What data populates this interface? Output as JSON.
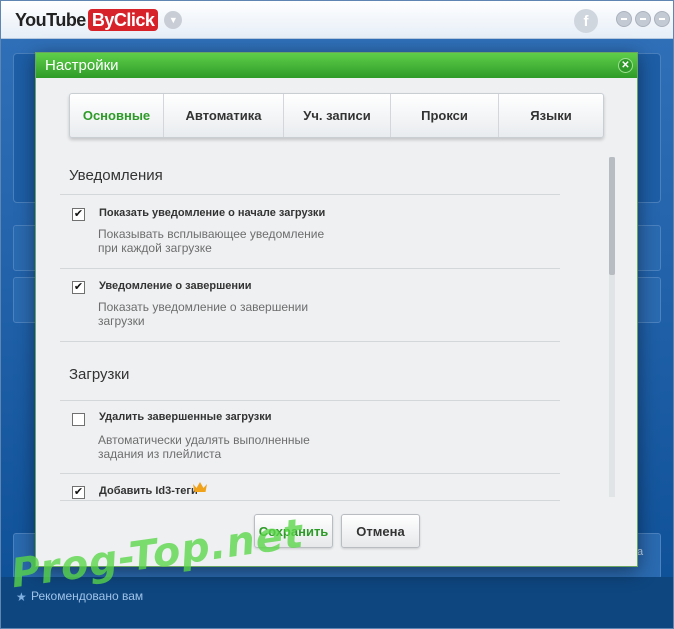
{
  "app": {
    "logo_part1": "YouTube",
    "logo_part2": "ByClick",
    "menu_icon": "chevron-down-icon",
    "facebook_icon": "facebook-icon",
    "facebook_glyph": "f",
    "background_bottom_text": "Рекомендовано вам",
    "background_side_text": "a"
  },
  "dialog": {
    "title": "Настройки",
    "close_icon": "close-icon",
    "tabs": [
      {
        "label": "Основные",
        "active": true
      },
      {
        "label": "Автоматика",
        "active": false
      },
      {
        "label": "Уч. записи",
        "active": false
      },
      {
        "label": "Прокси",
        "active": false
      },
      {
        "label": "Языки",
        "active": false
      }
    ],
    "sections": [
      {
        "title": "Уведомления",
        "options": [
          {
            "label": "Показать уведомление о начале загрузки",
            "checked": true,
            "description": "Показывать всплывающее уведомление при каждой загрузке"
          },
          {
            "label": "Уведомление о завершении",
            "checked": true,
            "description": "Показать уведомление о завершении загрузки"
          }
        ]
      },
      {
        "title": "Загрузки",
        "options": [
          {
            "label": "Удалить завершенные загрузки",
            "checked": false,
            "description": "Автоматически удалять выполненные задания из плейлиста"
          },
          {
            "label": "Добавить Id3-теги",
            "checked": true,
            "premium_icon": "crown-icon"
          }
        ]
      }
    ],
    "buttons": {
      "save": "Сохранить",
      "cancel": "Отмена"
    }
  },
  "watermark": "Prog-Top.net",
  "colors": {
    "accent_green": "#2e9b28",
    "header_green": "#4cbb3c",
    "app_blue": "#0d4f96",
    "logo_red": "#d8222a"
  }
}
